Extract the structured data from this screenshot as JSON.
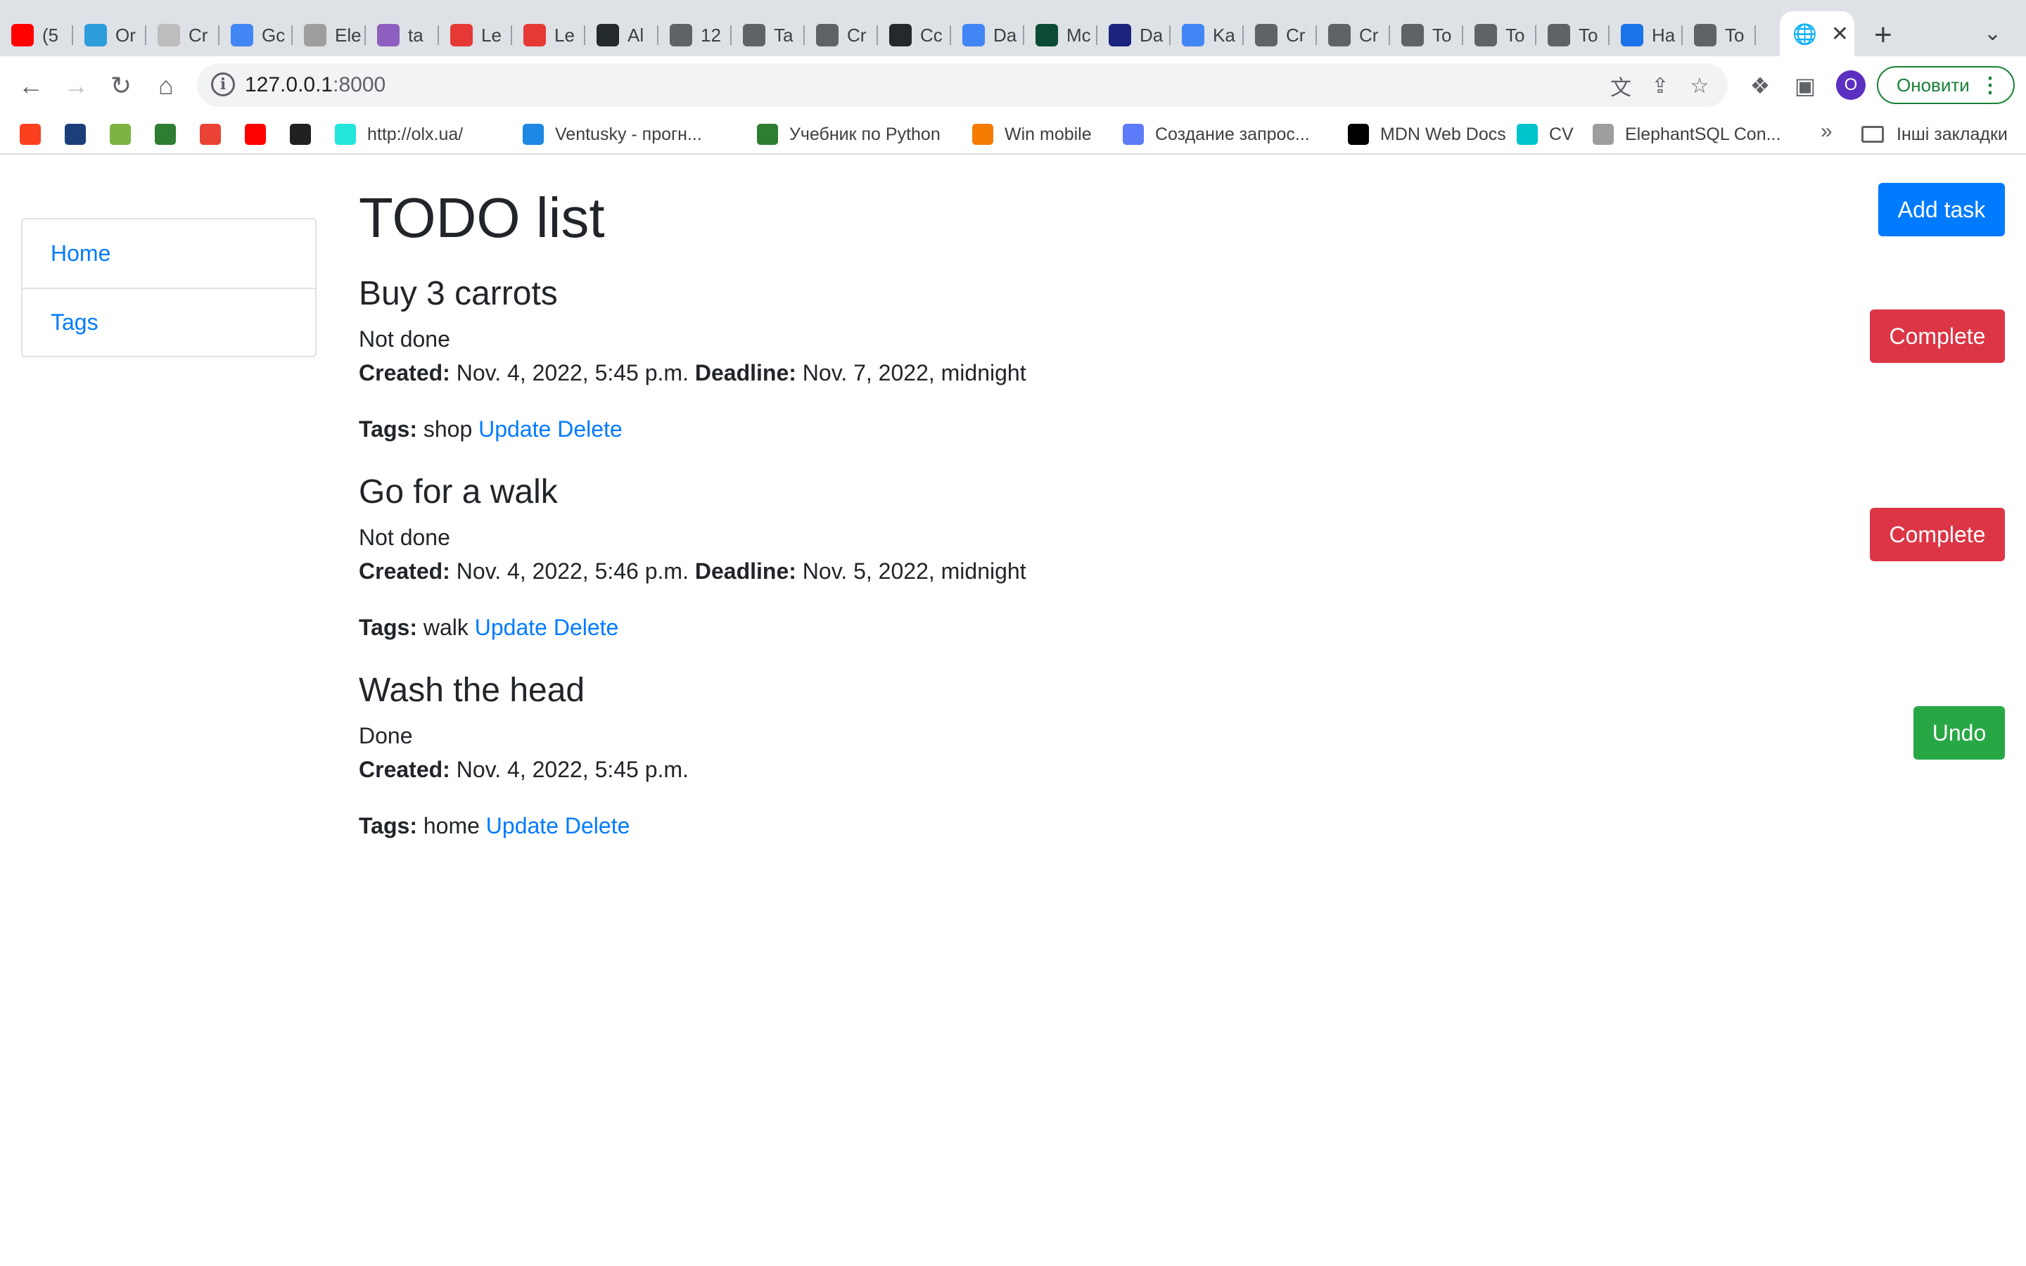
{
  "browser": {
    "tabs": [
      {
        "label": "(5",
        "icon": "youtube-icon",
        "color": "#ff0000"
      },
      {
        "label": "Or",
        "icon": "ts-icon",
        "color": "#2d9cdb"
      },
      {
        "label": "Cr",
        "icon": "document-icon",
        "color": "#bdbdbd"
      },
      {
        "label": "Gc",
        "icon": "google-translate-icon",
        "color": "#4285f4"
      },
      {
        "label": "Ele",
        "icon": "elephant-icon",
        "color": "#9e9e9e"
      },
      {
        "label": "ta",
        "icon": "h-icon",
        "color": "#8e5fbf"
      },
      {
        "label": "Le",
        "icon": "mate-icon",
        "color": "#e53935"
      },
      {
        "label": "Le",
        "icon": "mate-icon",
        "color": "#e53935"
      },
      {
        "label": "Al",
        "icon": "github-icon",
        "color": "#24292e"
      },
      {
        "label": "12",
        "icon": "globe-icon",
        "color": "#5f6368"
      },
      {
        "label": "Ta",
        "icon": "globe-icon",
        "color": "#5f6368"
      },
      {
        "label": "Cr",
        "icon": "globe-icon",
        "color": "#5f6368"
      },
      {
        "label": "Cc",
        "icon": "github-icon",
        "color": "#24292e"
      },
      {
        "label": "Da",
        "icon": "google-icon",
        "color": "#4285f4"
      },
      {
        "label": "Mc",
        "icon": "django-icon",
        "color": "#0c4b33"
      },
      {
        "label": "Da",
        "icon": "diamond-icon",
        "color": "#1a237e"
      },
      {
        "label": "Ka",
        "icon": "google-icon",
        "color": "#4285f4"
      },
      {
        "label": "Cr",
        "icon": "globe-icon",
        "color": "#5f6368"
      },
      {
        "label": "Cr",
        "icon": "globe-icon",
        "color": "#5f6368"
      },
      {
        "label": "To",
        "icon": "globe-icon",
        "color": "#5f6368"
      },
      {
        "label": "To",
        "icon": "globe-icon",
        "color": "#5f6368"
      },
      {
        "label": "To",
        "icon": "globe-icon",
        "color": "#5f6368"
      },
      {
        "label": "Ha",
        "icon": "gear-icon",
        "color": "#1a73e8"
      },
      {
        "label": "To",
        "icon": "globe-icon",
        "color": "#5f6368"
      }
    ],
    "url_host": "127.0.0.1",
    "url_port": ":8000",
    "update_label": "Оновити",
    "profile_initial": "O",
    "bookmarks": [
      {
        "label": "",
        "icon": "yandex-icon",
        "color": "#fc3f1d"
      },
      {
        "label": "",
        "icon": "lb-icon",
        "color": "#1c3f7a"
      },
      {
        "label": "",
        "icon": "star-flower-icon",
        "color": "#7cb342"
      },
      {
        "label": "",
        "icon": "green-circle-icon",
        "color": "#2e7d32"
      },
      {
        "label": "",
        "icon": "gmail-icon",
        "color": "#ea4335"
      },
      {
        "label": "",
        "icon": "youtube-icon",
        "color": "#ff0000"
      },
      {
        "label": "",
        "icon": "calculator-icon",
        "color": "#212121"
      },
      {
        "label": "http://olx.ua/",
        "icon": "olx-icon",
        "color": "#23e5db"
      },
      {
        "label": "Ventusky - прогн...",
        "icon": "ventusky-icon",
        "color": "#1e88e5"
      },
      {
        "label": "Учебник по Python",
        "icon": "w-icon",
        "color": "#2e7d32"
      },
      {
        "label": "Win mobile",
        "icon": "win-mobile-icon",
        "color": "#f57c00"
      },
      {
        "label": "Создание запрос...",
        "icon": "dj-icon",
        "color": "#5c7cfa"
      },
      {
        "label": "MDN Web Docs",
        "icon": "mdn-icon",
        "color": "#000000"
      },
      {
        "label": "CV",
        "icon": "canva-icon",
        "color": "#00c4cc"
      },
      {
        "label": "ElephantSQL Con...",
        "icon": "elephant-icon",
        "color": "#9e9e9e"
      }
    ],
    "more_bookmarks": "»",
    "other_bookmarks": "Інші закладки"
  },
  "sidebar": {
    "items": [
      {
        "label": "Home"
      },
      {
        "label": "Tags"
      }
    ]
  },
  "main": {
    "title": "TODO list",
    "add_task_label": "Add task",
    "created_label": "Created:",
    "deadline_label": "Deadline:",
    "tags_label": "Tags:",
    "update_label": "Update",
    "delete_label": "Delete",
    "tasks": [
      {
        "title": "Buy 3 carrots",
        "status": "Not done",
        "created": "Nov. 4, 2022, 5:45 p.m.",
        "deadline": "Nov. 7, 2022, midnight",
        "tags": "shop",
        "action": "Complete"
      },
      {
        "title": "Go for a walk",
        "status": "Not done",
        "created": "Nov. 4, 2022, 5:46 p.m.",
        "deadline": "Nov. 5, 2022, midnight",
        "tags": "walk",
        "action": "Complete"
      },
      {
        "title": "Wash the head",
        "status": "Done",
        "created": "Nov. 4, 2022, 5:45 p.m.",
        "tags": "home",
        "action": "Undo"
      }
    ]
  },
  "colors": {
    "primary": "#007bff",
    "danger": "#dc3545",
    "success": "#28a745"
  }
}
